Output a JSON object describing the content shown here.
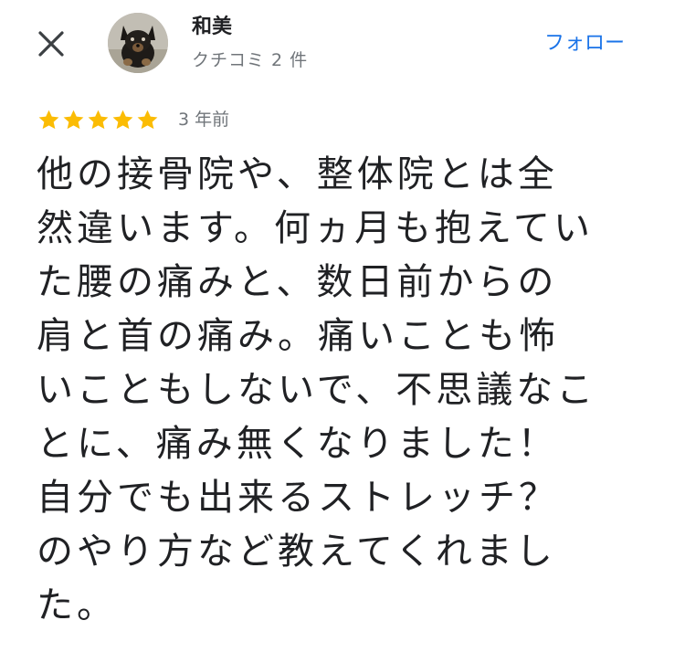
{
  "header": {
    "close_icon": "close-icon",
    "reviewer": {
      "name": "和美",
      "meta": "クチコミ 2 件",
      "avatar_icon": "avatar-dog-photo"
    },
    "follow_label": "フォロー",
    "accent_color": "#1a73e8"
  },
  "review": {
    "rating": 5,
    "max_rating": 5,
    "star_color": "#fbbc04",
    "date": "3 年前",
    "text": "他の接骨院や、整体院とは全\n然違います。何ヵ月も抱えてい\nた腰の痛みと、数日前からの\n肩と首の痛み。痛いことも怖\nいこともしないで、不思議なこ\nとに、痛み無くなりました！\n自分でも出来るストレッチ？\nのやり方など教えてくれまし\nた。"
  }
}
